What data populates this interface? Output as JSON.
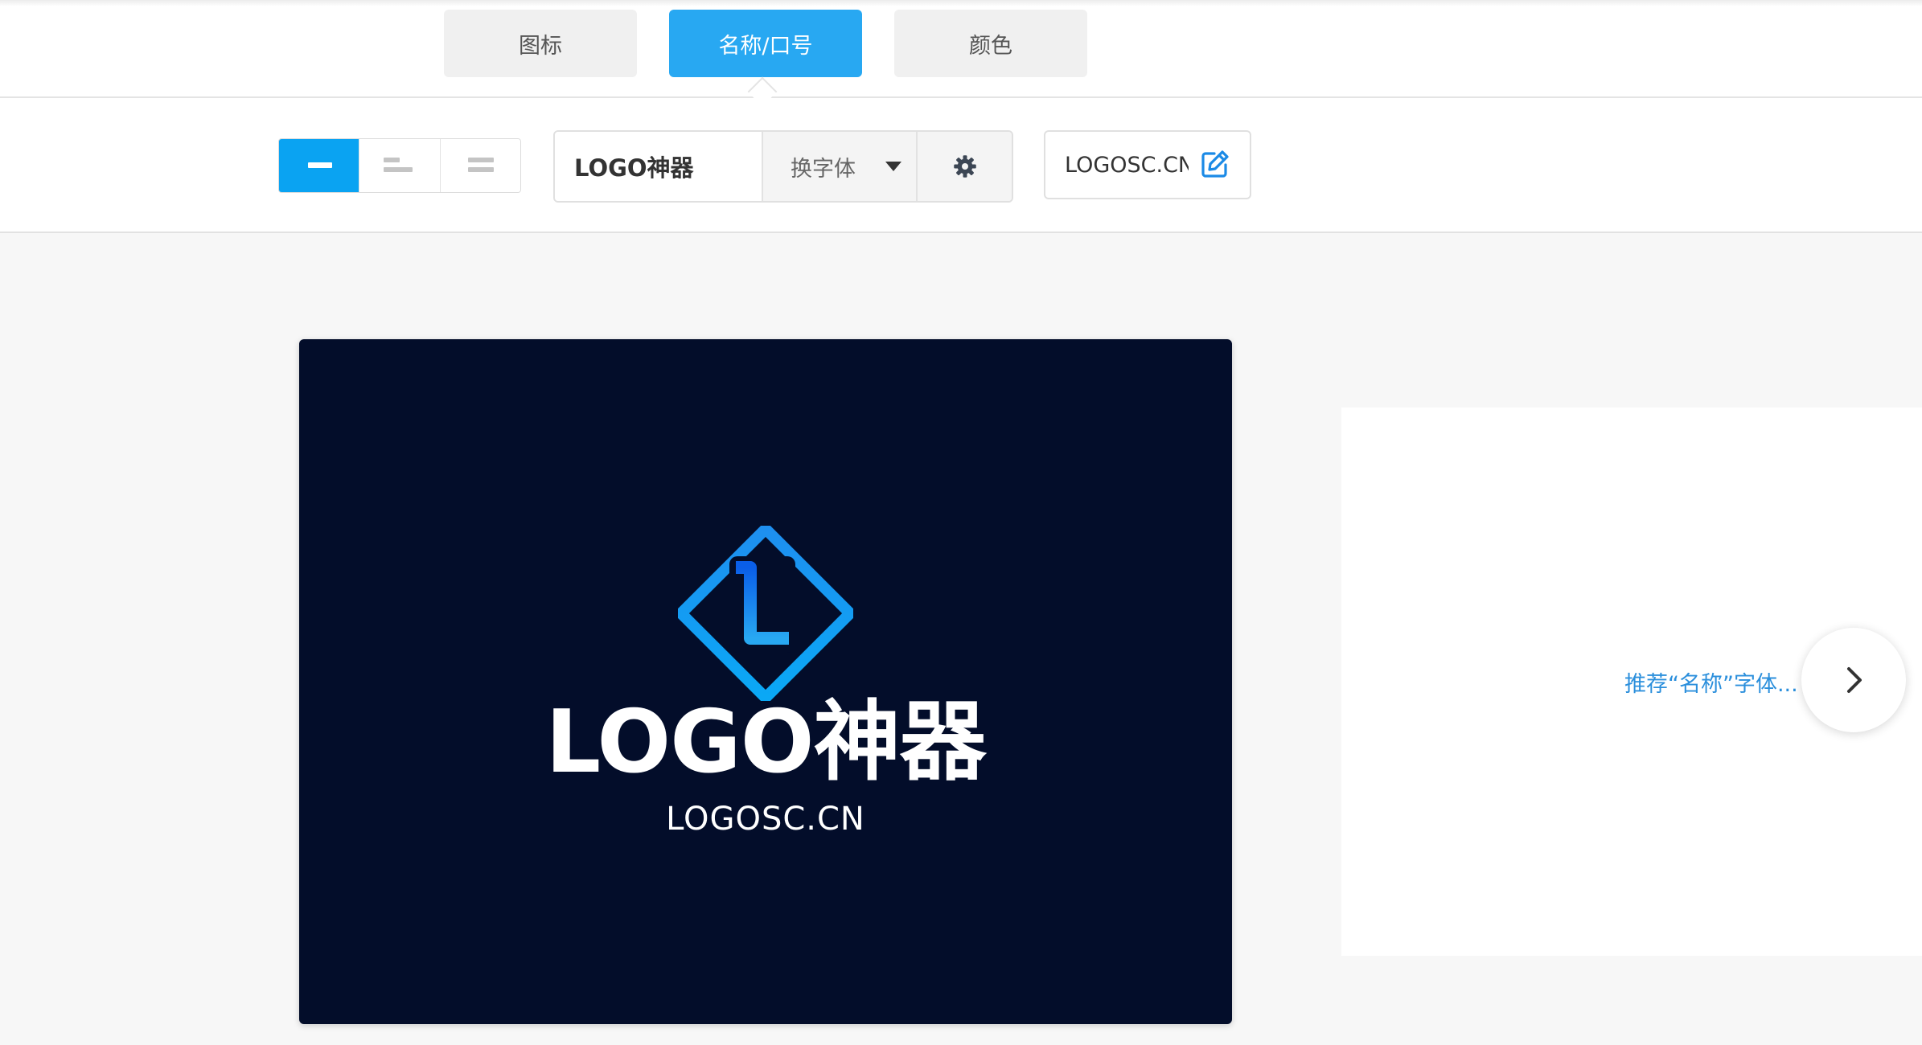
{
  "tabs": [
    {
      "label": "图标",
      "active": false
    },
    {
      "label": "名称/口号",
      "active": true
    },
    {
      "label": "颜色",
      "active": false
    }
  ],
  "toolbar": {
    "layout_options": [
      "layout-center-icon",
      "layout-left-icon",
      "layout-stacked-icon"
    ],
    "active_layout": "layout-center-icon",
    "name_value": "LOGO神器",
    "font_label": "换字体",
    "settings_icon": "gear-icon",
    "slogan_value": "LOGOSC.CN",
    "edit_icon": "pencil-square-icon"
  },
  "preview": {
    "icon": "diamond-L-icon",
    "name": "LOGO神器",
    "slogan": "LOGOSC.CN",
    "background": "#030d2a",
    "icon_gradient": [
      "#28a8f2",
      "#0a5ee8"
    ]
  },
  "recommend": {
    "text": "推荐“名称”字体...",
    "next_icon": "chevron-right-icon"
  },
  "colors": {
    "accent": "#28a8f2",
    "link": "#2b8fdc"
  }
}
